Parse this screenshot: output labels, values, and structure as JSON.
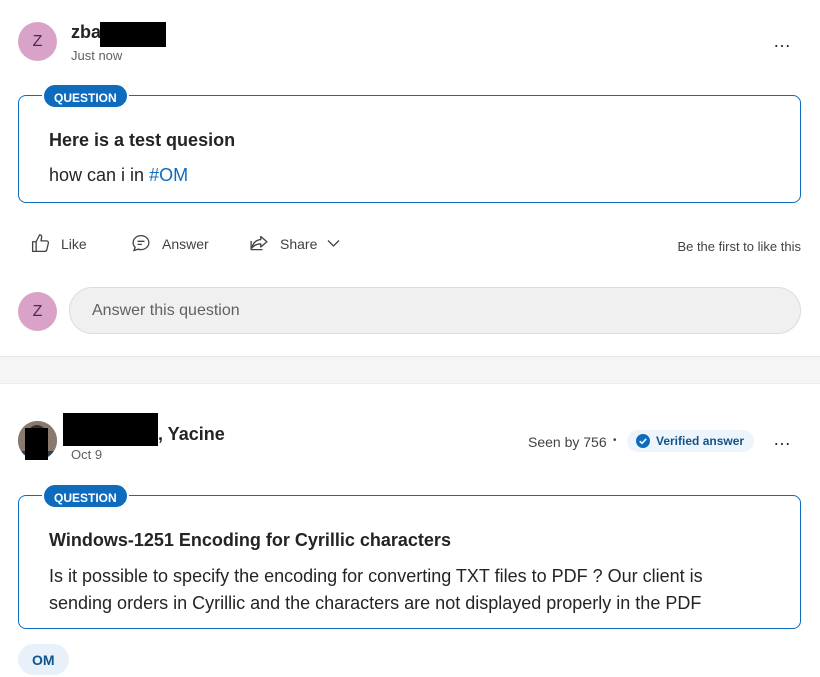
{
  "post1": {
    "avatar_initial": "Z",
    "author_name": "zba",
    "timestamp": "Just now",
    "more_label": "…",
    "badge": "QUESTION",
    "title": "Here is a test quesion",
    "body_text": "how can i in ",
    "hashtag": "#OM",
    "actions": {
      "like": "Like",
      "answer": "Answer",
      "share": "Share"
    },
    "like_hint": "Be the first to like this",
    "reply": {
      "avatar_initial": "Z",
      "placeholder": "Answer this question"
    }
  },
  "post2": {
    "author_name": ", Yacine",
    "timestamp": "Oct 9",
    "seen_by": "Seen by 756",
    "separator": "•",
    "verified_label": "Verified answer",
    "more_label": "…",
    "badge": "QUESTION",
    "title": "Windows-1251 Encoding for Cyrillic characters",
    "body_line1": "Is it possible to specify the encoding for converting TXT files to PDF ? Our client is",
    "body_line2": "sending orders in Cyrillic and the characters are not displayed properly in the PDF",
    "tag": "OM"
  },
  "colors": {
    "accent": "#0f6cbd",
    "avatar_bg": "#d9a3c9",
    "redaction": "#000000"
  },
  "icons": [
    "like-icon",
    "answer-icon",
    "share-icon",
    "chevron-down-icon",
    "verified-check-icon",
    "more-options-icon"
  ]
}
